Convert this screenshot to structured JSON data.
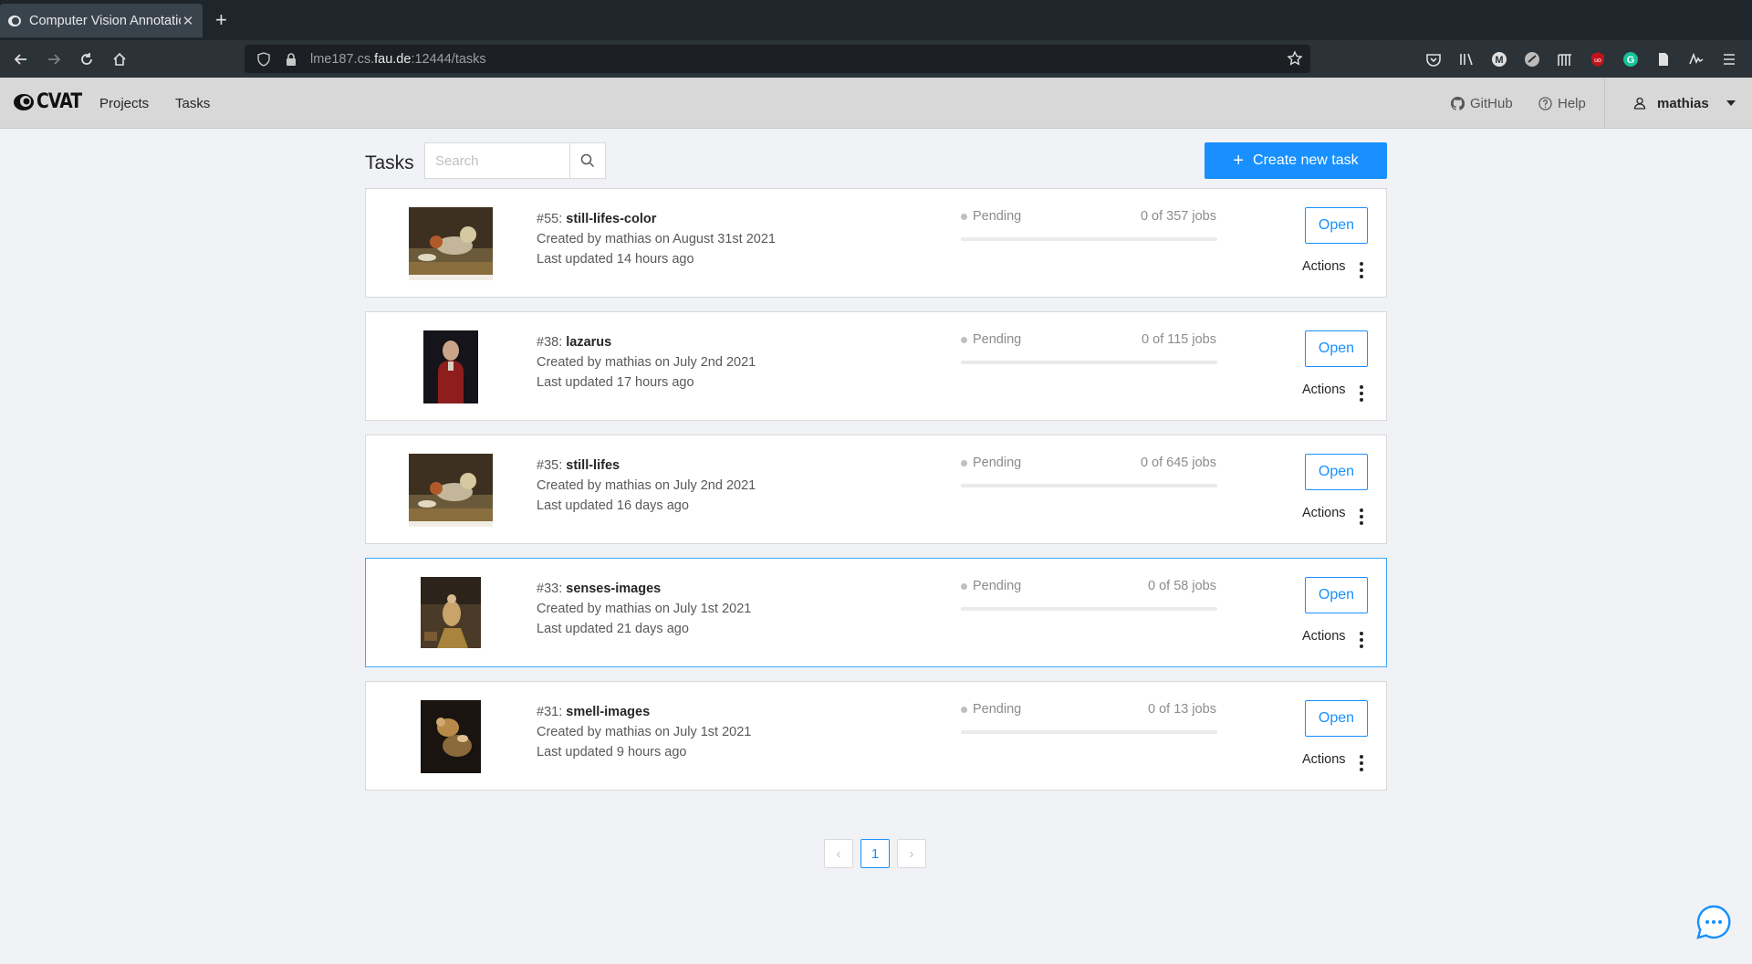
{
  "browser": {
    "tab_title": "Computer Vision Annotation Tool",
    "tab_title_visible": "Computer Vision Annotatio",
    "url_prefix": "lme187.cs.",
    "url_domain": "fau.de",
    "url_suffix": ":12444/tasks"
  },
  "header": {
    "logo_text": "CVAT",
    "nav": [
      {
        "label": "Projects"
      },
      {
        "label": "Tasks"
      }
    ],
    "github_label": "GitHub",
    "help_label": "Help",
    "user_name": "mathias"
  },
  "page": {
    "title": "Tasks",
    "search_placeholder": "Search",
    "create_button_label": "Create new task",
    "create_button_plus": "+"
  },
  "tasks": [
    {
      "id_label": "#55: ",
      "name": "still-lifes-color",
      "created": "Created by mathias on August 31st 2021",
      "updated": "Last updated 14 hours ago",
      "status": "Pending",
      "jobs": "0 of 357 jobs",
      "progress": 0,
      "open_label": "Open",
      "actions_label": "Actions",
      "thumb": "still-life"
    },
    {
      "id_label": "#38: ",
      "name": "lazarus",
      "created": "Created by mathias on July 2nd 2021",
      "updated": "Last updated 17 hours ago",
      "status": "Pending",
      "jobs": "0 of 115 jobs",
      "progress": 0,
      "open_label": "Open",
      "actions_label": "Actions",
      "thumb": "portrait"
    },
    {
      "id_label": "#35: ",
      "name": "still-lifes",
      "created": "Created by mathias on July 2nd 2021",
      "updated": "Last updated 16 days ago",
      "status": "Pending",
      "jobs": "0 of 645 jobs",
      "progress": 0,
      "open_label": "Open",
      "actions_label": "Actions",
      "thumb": "still-life"
    },
    {
      "id_label": "#33: ",
      "name": "senses-images",
      "created": "Created by mathias on July 1st 2021",
      "updated": "Last updated 21 days ago",
      "status": "Pending",
      "jobs": "0 of 58 jobs",
      "progress": 0,
      "open_label": "Open",
      "actions_label": "Actions",
      "thumb": "senses"
    },
    {
      "id_label": "#31: ",
      "name": "smell-images",
      "created": "Created by mathias on July 1st 2021",
      "updated": "Last updated 9 hours ago",
      "status": "Pending",
      "jobs": "0 of 13 jobs",
      "progress": 0,
      "open_label": "Open",
      "actions_label": "Actions",
      "thumb": "dark-genre"
    }
  ],
  "pagination": {
    "prev": "‹",
    "current": "1",
    "next": "›"
  },
  "colors": {
    "accent": "#1890ff",
    "header_bg": "#d8d8d8",
    "page_bg": "#f0f2f5"
  }
}
